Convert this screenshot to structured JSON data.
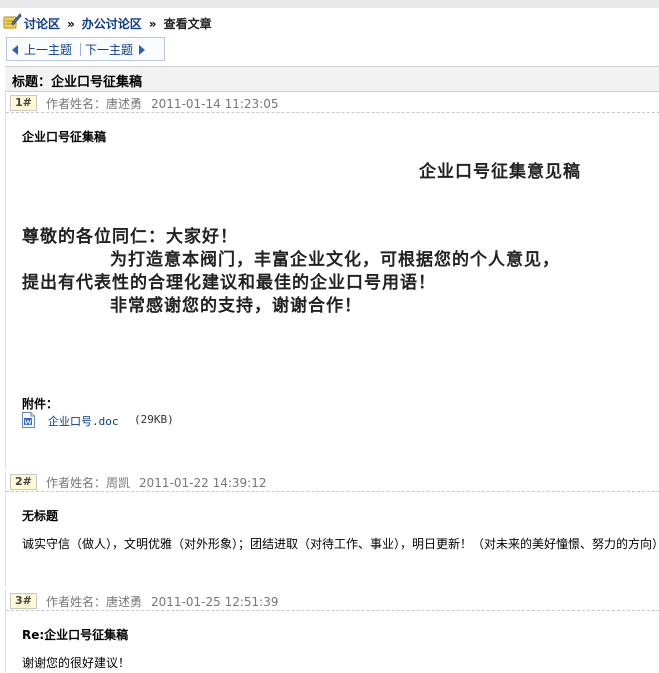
{
  "breadcrumb": {
    "items": [
      "讨论区",
      "办公讨论区"
    ],
    "separator": "»",
    "current": "查看文章"
  },
  "nav": {
    "prev": "上一主题",
    "next": "下一主题"
  },
  "thread": {
    "title_label": "标题：",
    "title": "企业口号征集稿"
  },
  "posts": [
    {
      "floor": "1#",
      "author_label": "作者姓名：",
      "author": "唐述勇",
      "time": "2011-01-14 11:23:05",
      "title": "企业口号征集稿",
      "body_heading": "企业口号征集意见稿",
      "body_lines": [
        "尊敬的各位同仁：大家好！",
        "为打造意本阀门，丰富企业文化，可根据您的个人意见，",
        "提出有代表性的合理化建议和最佳的企业口号用语！",
        "非常感谢您的支持，谢谢合作！"
      ],
      "attachment_label": "附件：",
      "attachment_name": "企业口号.doc",
      "attachment_size": "(29KB)"
    },
    {
      "floor": "2#",
      "author_label": "作者姓名：",
      "author": "周凯",
      "time": "2011-01-22 14:39:12",
      "title": "无标题",
      "body": "诚实守信（做人），文明优雅（对外形象）；团结进取（对待工作、事业），明日更新！（对未来的美好憧憬、努力的方向）"
    },
    {
      "floor": "3#",
      "author_label": "作者姓名：",
      "author": "唐述勇",
      "time": "2011-01-25 12:51:39",
      "title": "Re:企业口号征集稿",
      "body": "谢谢您的很好建议！"
    }
  ],
  "colors": {
    "link": "#0b3b8c",
    "floor_bg": "#fff9d6",
    "title_bar_bg": "#f2f2f2"
  },
  "icons": {
    "breadcrumb": "forum-icon",
    "attachment": "word-doc-icon",
    "prev": "triangle-left-icon",
    "next": "triangle-right-icon"
  }
}
